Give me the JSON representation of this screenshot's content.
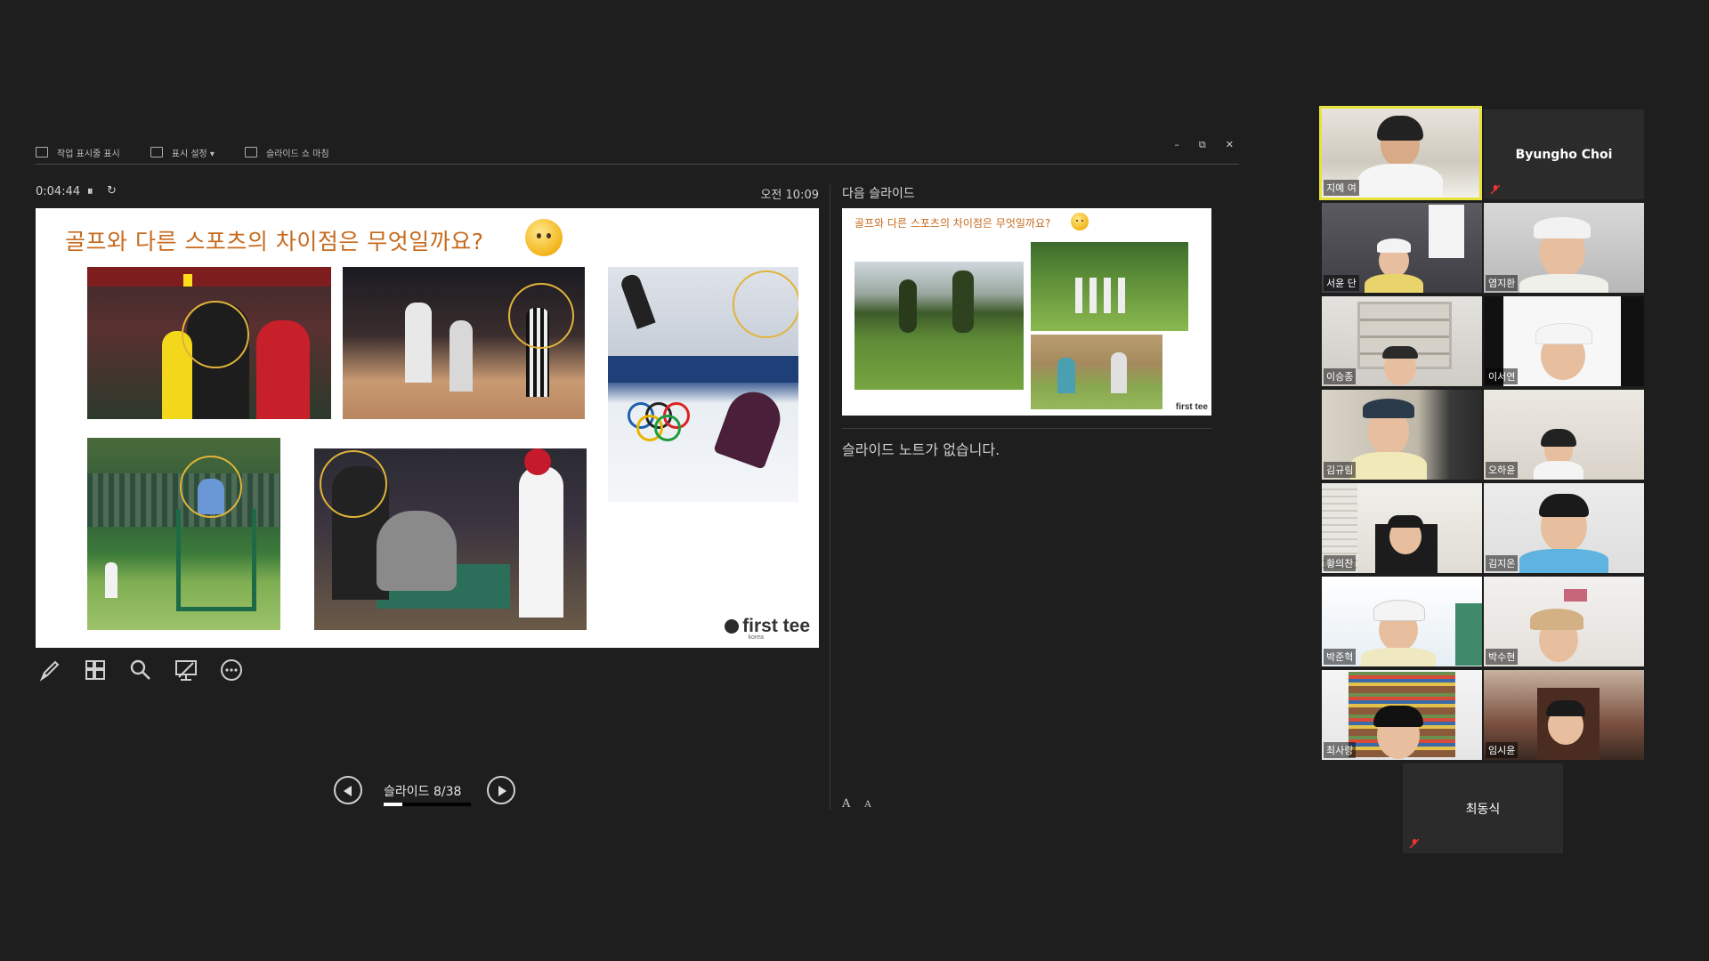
{
  "toolbar": {
    "taskbar_label": "작업 표시줄 표시",
    "display_settings_label": "표시 설정 ▾",
    "end_show_label": "슬라이드 쇼 마침"
  },
  "window_controls": {
    "minimize": "–",
    "restore": "⧉",
    "close": "✕"
  },
  "presenter": {
    "elapsed_time": "0:04:44",
    "pause_icon": "⏸",
    "reset_icon": "↻",
    "clock": "오전 10:09",
    "next_slide_label": "다음 슬라이드",
    "notes": "슬라이드 노트가 없습니다.",
    "slide_counter": "슬라이드 8/38",
    "current_slide": 8,
    "total_slides": 38,
    "font_increase": "A",
    "font_decrease": "A"
  },
  "slide": {
    "title": "골프와 다른 스포츠의 차이점은 무엇일까요?",
    "logo_text": "first tee",
    "logo_sub": "korea"
  },
  "next_slide": {
    "title": "골프와 다른 스포츠의 차이점은 무엇일까요?",
    "logo_text": "first tee"
  },
  "tools": [
    "pen-icon",
    "grid-icon",
    "zoom-icon",
    "screen-icon",
    "more-icon"
  ],
  "participants": [
    {
      "name": "지예 여",
      "active": true
    },
    {
      "name": "Byungho Choi",
      "video": false,
      "muted": true
    },
    {
      "name": "서윤 단"
    },
    {
      "name": "염지환"
    },
    {
      "name": "이승종"
    },
    {
      "name": "이서연"
    },
    {
      "name": "김규림"
    },
    {
      "name": "오하윤"
    },
    {
      "name": "황의찬"
    },
    {
      "name": "김지온"
    },
    {
      "name": "박준혁"
    },
    {
      "name": "박수현"
    },
    {
      "name": "최사랑"
    },
    {
      "name": "임시윤"
    },
    {
      "name": "최동식",
      "video": false,
      "muted": true
    }
  ],
  "colors": {
    "accent_title": "#c66a1d",
    "active_speaker": "#e6e23a",
    "background": "#1e1e1e"
  }
}
